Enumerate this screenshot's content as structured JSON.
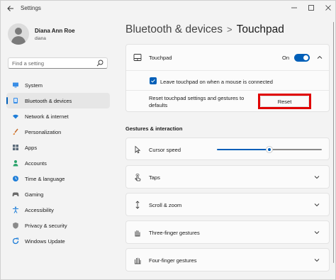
{
  "window": {
    "title": "Settings",
    "back_icon": "arrow-left",
    "controls": [
      "minimize",
      "maximize",
      "close"
    ]
  },
  "profile": {
    "name": "Diana Ann Roe",
    "email": "diana"
  },
  "search": {
    "placeholder": "Find a setting",
    "icon": "search-icon"
  },
  "nav": {
    "items": [
      {
        "label": "System",
        "icon": "monitor-icon",
        "active": false
      },
      {
        "label": "Bluetooth & devices",
        "icon": "bluetooth-icon",
        "active": true
      },
      {
        "label": "Network & internet",
        "icon": "wifi-icon",
        "active": false
      },
      {
        "label": "Personalization",
        "icon": "brush-icon",
        "active": false
      },
      {
        "label": "Apps",
        "icon": "apps-icon",
        "active": false
      },
      {
        "label": "Accounts",
        "icon": "person-icon",
        "active": false
      },
      {
        "label": "Time & language",
        "icon": "globe-clock-icon",
        "active": false
      },
      {
        "label": "Gaming",
        "icon": "controller-icon",
        "active": false
      },
      {
        "label": "Accessibility",
        "icon": "accessibility-icon",
        "active": false
      },
      {
        "label": "Privacy & security",
        "icon": "shield-icon",
        "active": false
      },
      {
        "label": "Windows Update",
        "icon": "update-icon",
        "active": false
      }
    ]
  },
  "breadcrumb": {
    "parent": "Bluetooth & devices",
    "separator": ">",
    "current": "Touchpad"
  },
  "touchpad_card": {
    "label": "Touchpad",
    "toggle_state": "On",
    "checkbox_label": "Leave touchpad on when a mouse is connected",
    "checkbox_checked": true,
    "reset_label": "Reset touchpad settings and gestures to defaults",
    "reset_button": "Reset"
  },
  "gestures": {
    "section_title": "Gestures & interaction",
    "cursor_speed": {
      "label": "Cursor speed",
      "value_fraction": 0.5
    },
    "items": [
      {
        "label": "Taps",
        "icon": "tap-icon"
      },
      {
        "label": "Scroll & zoom",
        "icon": "scroll-icon"
      },
      {
        "label": "Three-finger gestures",
        "icon": "three-finger-icon"
      },
      {
        "label": "Four-finger gestures",
        "icon": "four-finger-icon"
      }
    ]
  },
  "colors": {
    "accent": "#005fb8",
    "highlight": "#e00000",
    "background": "#f3f3f3",
    "card": "#fbfbfb"
  }
}
